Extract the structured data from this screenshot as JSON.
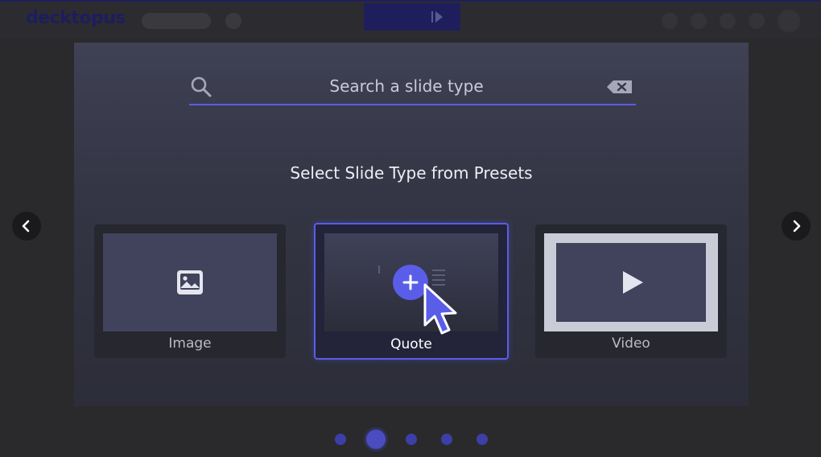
{
  "app": {
    "logo_text": "decktopus"
  },
  "search": {
    "placeholder": "Search a slide type",
    "value": ""
  },
  "picker": {
    "heading": "Select Slide Type from Presets",
    "presets": [
      {
        "label": "Image",
        "icon": "image-icon"
      },
      {
        "label": "Quote",
        "icon": "add-icon",
        "selected": true
      },
      {
        "label": "Video",
        "icon": "play-icon"
      }
    ]
  },
  "pagination": {
    "count": 5,
    "active_index": 1
  },
  "colors": {
    "accent": "#5a5de8",
    "brand_dark": "#1f1e5c",
    "modal_bg": "#383a4b",
    "card_bg": "#26272f",
    "thumb_bg": "#41425c"
  }
}
